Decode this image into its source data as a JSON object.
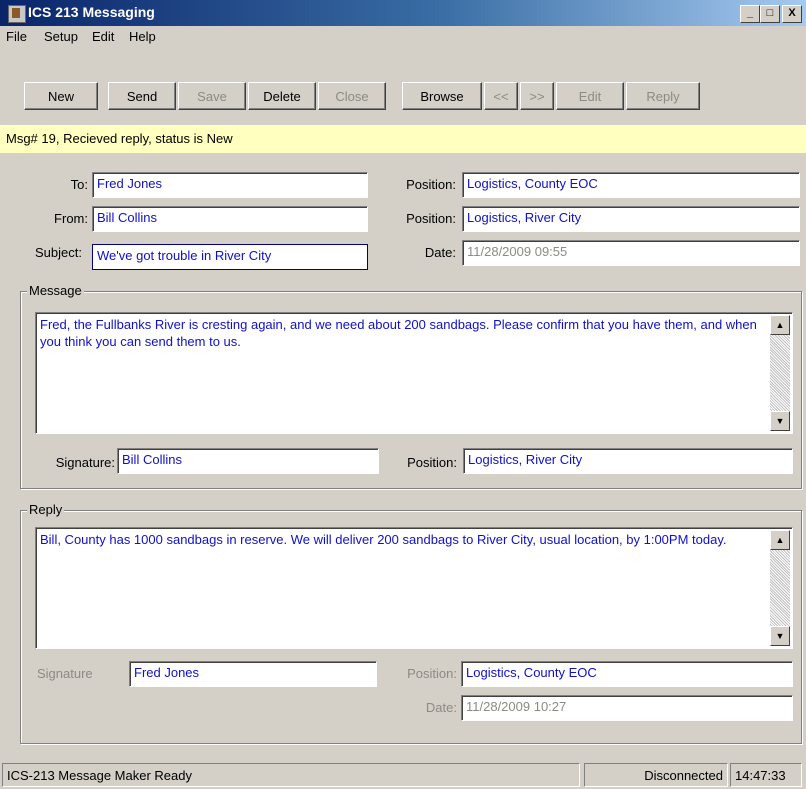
{
  "window": {
    "title": "ICS 213 Messaging",
    "controls": [
      "_",
      "□",
      "X"
    ]
  },
  "menu": [
    "File",
    "Setup",
    "Edit",
    "Help"
  ],
  "toolbar": {
    "new": "New",
    "send": "Send",
    "save": "Save",
    "delete": "Delete",
    "close": "Close",
    "browse": "Browse",
    "prev": "<<",
    "next": ">>",
    "edit": "Edit",
    "reply": "Reply"
  },
  "status_message": "Msg# 19,  Recieved reply, status is New",
  "header": {
    "to_label": "To:",
    "to_value": "Fred Jones",
    "from_label": "From:",
    "from_value": "Bill Collins",
    "subject_label": "Subject:",
    "subject_value": "We've got trouble in River City",
    "to_position_label": "Position:",
    "to_position_value": "Logistics, County EOC",
    "from_position_label": "Position:",
    "from_position_value": "Logistics, River City",
    "date_label": "Date:",
    "date_value": "11/28/2009 09:55"
  },
  "message": {
    "group_title": "Message",
    "body": "Fred, the Fullbanks River is cresting again, and we need about 200 sandbags.  Please confirm that you have them, and when you think you can send them to us.",
    "signature_label": "Signature:",
    "signature_value": "Bill Collins",
    "position_label": "Position:",
    "position_value": "Logistics, River City"
  },
  "reply": {
    "group_title": "Reply",
    "body": "Bill, County has 1000 sandbags in reserve.  We will deliver 200 sandbags to River City, usual location, by 1:00PM today.",
    "signature_label": "Signature",
    "signature_value": "Fred Jones",
    "position_label": "Position:",
    "position_value": "Logistics, County EOC",
    "date_label": "Date:",
    "date_value": "11/28/2009 10:27"
  },
  "statusbar": {
    "ready": "ICS-213 Message Maker Ready",
    "connection": "Disconnected",
    "time": "14:47:33"
  },
  "icons": {
    "scroll_up": "▲",
    "scroll_down": "▼"
  }
}
